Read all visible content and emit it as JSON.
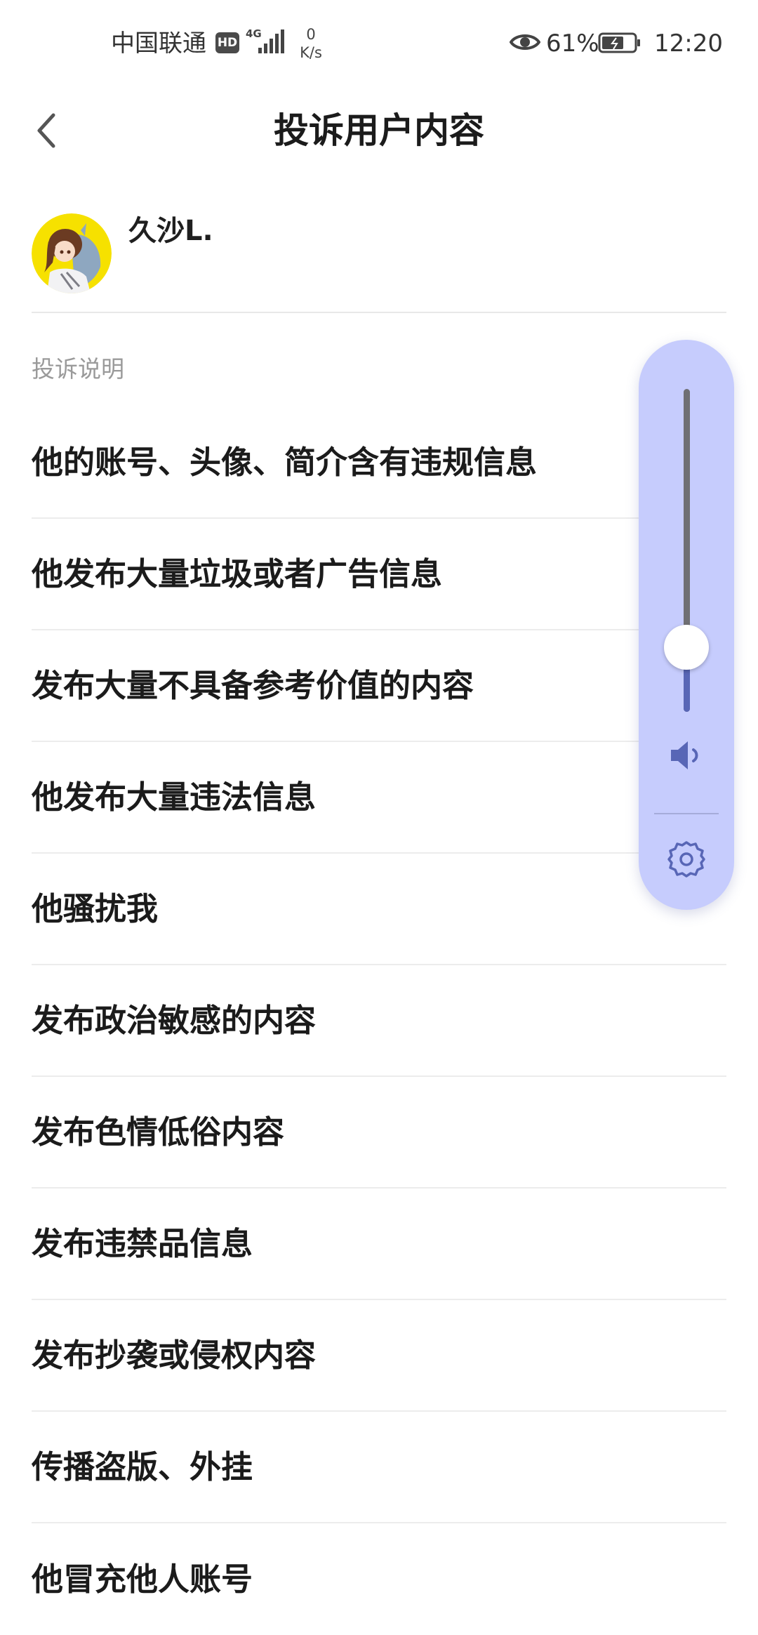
{
  "status_bar": {
    "carrier": "中国联通",
    "hd_badge": "HD",
    "network_type": "4G",
    "speed_value": "0",
    "speed_unit": "K/s",
    "battery_percent": "61%",
    "time": "12:20",
    "icons": [
      "hd-icon",
      "signal-icon",
      "eye-icon",
      "battery-icon"
    ]
  },
  "header": {
    "title": "投诉用户内容",
    "back_icon": "chevron-left-icon"
  },
  "user": {
    "name": "久沙L."
  },
  "section": {
    "label": "投诉说明"
  },
  "reasons": [
    {
      "label": "他的账号、头像、简介含有违规信息"
    },
    {
      "label": "他发布大量垃圾或者广告信息"
    },
    {
      "label": "发布大量不具备参考价值的内容"
    },
    {
      "label": "他发布大量违法信息"
    },
    {
      "label": "他骚扰我"
    },
    {
      "label": "发布政治敏感的内容"
    },
    {
      "label": "发布色情低俗内容"
    },
    {
      "label": "发布违禁品信息"
    },
    {
      "label": "发布抄袭或侵权内容"
    },
    {
      "label": "传播盗版、外挂"
    },
    {
      "label": "他冒充他人账号"
    }
  ],
  "volume_overlay": {
    "level": 0.2,
    "icons": [
      "speaker-icon",
      "gear-icon"
    ],
    "colors": {
      "panel": "#c6ccfd",
      "fill": "#5866b6",
      "track": "#6f6f74"
    }
  }
}
